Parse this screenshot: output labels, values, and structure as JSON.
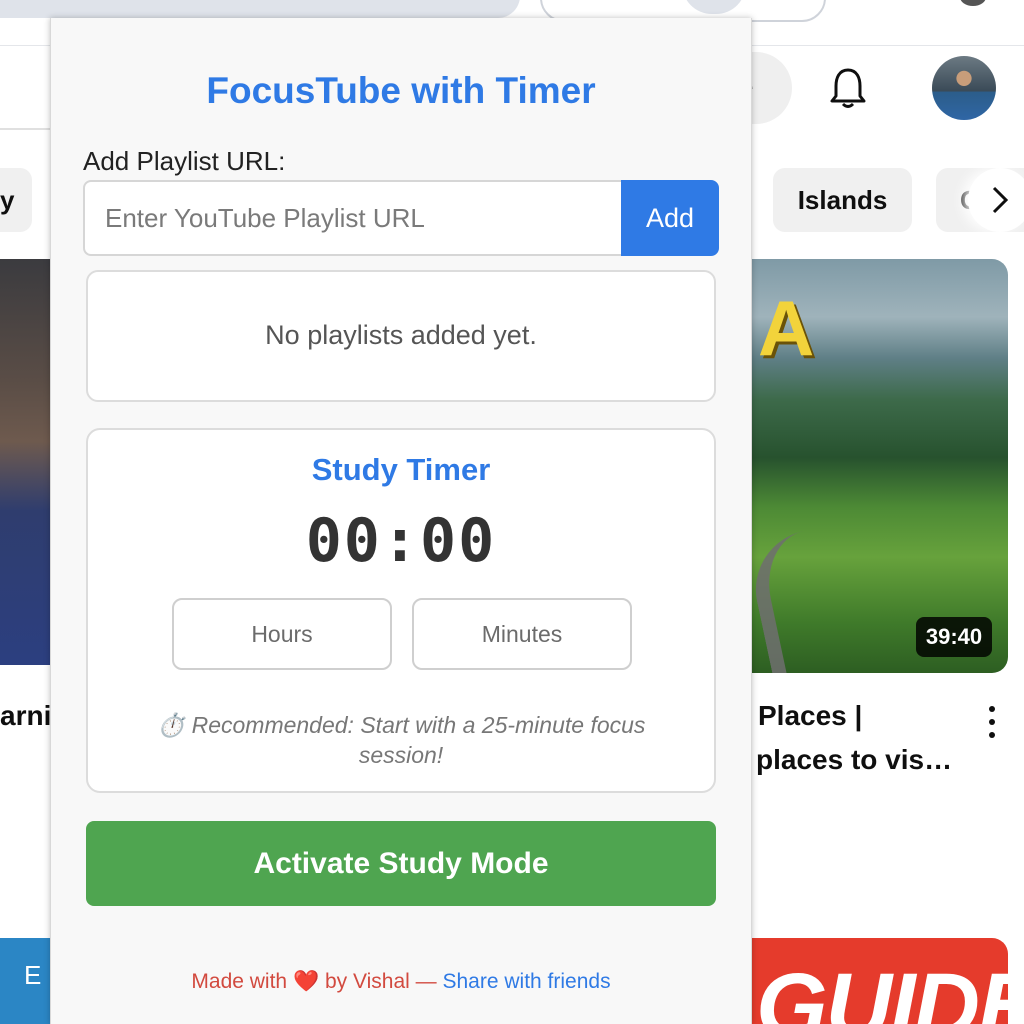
{
  "popup": {
    "title": "FocusTube with Timer",
    "playlist_label": "Add Playlist URL:",
    "url_placeholder": "Enter YouTube Playlist URL",
    "add_button": "Add",
    "empty_message": "No playlists added yet.",
    "timer": {
      "title": "Study Timer",
      "display": "00:00",
      "hours_placeholder": "Hours",
      "minutes_placeholder": "Minutes",
      "recommendation": "⏱️ Recommended: Start with a 25-minute focus session!"
    },
    "activate_button": "Activate Study Mode",
    "footer": {
      "made_with": "Made with",
      "heart": "❤️",
      "by": "by Vishal —",
      "share_link": "Share with friends"
    }
  },
  "background": {
    "create_fragment": "e",
    "chips": [
      "y",
      "Islands",
      "C"
    ],
    "video_duration": "39:40",
    "left_title_fragment": "arni",
    "right_title_line1": "Places |",
    "right_title_line2": "places to vis…",
    "left_thumb_letter": "A",
    "bottom_left_letter": "E",
    "bottom_right_text": "GUIDE"
  },
  "colors": {
    "accent_blue": "#2f7ae5",
    "activate_green": "#4fa550",
    "footer_red": "#d24a3f"
  }
}
